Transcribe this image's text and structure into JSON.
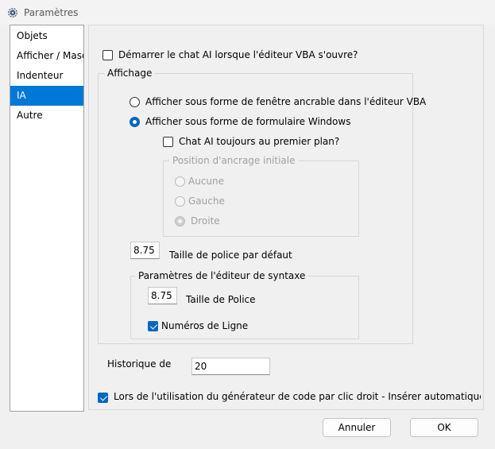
{
  "window": {
    "title": "Paramètres"
  },
  "nav": {
    "items": [
      "Objets",
      "Afficher / Masquer",
      "Indenteur",
      "IA",
      "Autre"
    ],
    "selected_index": 3
  },
  "settings": {
    "start_chat_label": "Démarrer le chat AI lorsque l'éditeur VBA s'ouvre?",
    "start_chat_checked": false,
    "affichage": {
      "legend": "Affichage",
      "option_dockable": "Afficher sous forme de fenêtre ancrable dans l'éditeur VBA",
      "option_form": "Afficher sous forme de formulaire Windows",
      "selected_option": "form",
      "always_on_top_label": "Chat AI toujours au premier plan?",
      "always_on_top_checked": false,
      "dock_position": {
        "legend": "Position d'ancrage initiale",
        "options": [
          "Aucune",
          "Gauche",
          "Droite"
        ],
        "selected": "Droite",
        "enabled": false
      },
      "font_size_value": "8.75",
      "font_size_label": "Taille de police par défaut",
      "syntax_editor": {
        "legend": "Paramètres de l'éditeur de syntaxe",
        "font_size_value": "8.75",
        "font_size_label": "Taille de Police",
        "line_numbers_label": "Numéros de Ligne",
        "line_numbers_checked": true
      }
    },
    "history_label": "Historique de",
    "history_value": "20",
    "auto_insert_label": "Lors de l'utilisation du générateur de code par clic droit - Insérer automatiquement le",
    "auto_insert_checked": true
  },
  "buttons": {
    "cancel": "Annuler",
    "ok": "OK"
  },
  "colors": {
    "accent": "#0067c0",
    "selection": "#0078d7"
  }
}
